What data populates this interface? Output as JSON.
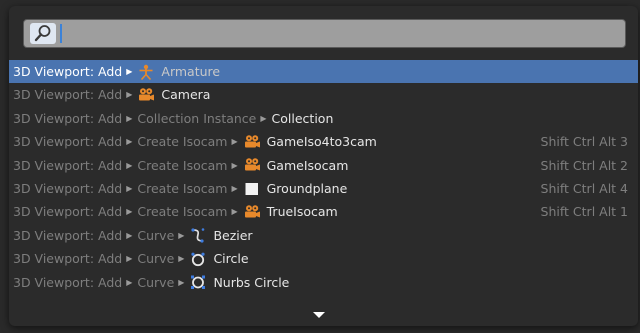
{
  "search": {
    "value": "",
    "placeholder": ""
  },
  "results": [
    {
      "path": [
        "3D Viewport: Add"
      ],
      "icon": "armature-icon",
      "label": "Armature",
      "shortcut": "",
      "selected": true
    },
    {
      "path": [
        "3D Viewport: Add"
      ],
      "icon": "camera-icon",
      "label": "Camera",
      "shortcut": "",
      "selected": false
    },
    {
      "path": [
        "3D Viewport: Add",
        "Collection Instance"
      ],
      "icon": "",
      "label": "Collection",
      "shortcut": "",
      "selected": false
    },
    {
      "path": [
        "3D Viewport: Add",
        "Create Isocam"
      ],
      "icon": "camera-icon",
      "label": "GameIso4to3cam",
      "shortcut": "Shift Ctrl Alt 3",
      "selected": false
    },
    {
      "path": [
        "3D Viewport: Add",
        "Create Isocam"
      ],
      "icon": "camera-icon",
      "label": "GameIsocam",
      "shortcut": "Shift Ctrl Alt 2",
      "selected": false
    },
    {
      "path": [
        "3D Viewport: Add",
        "Create Isocam"
      ],
      "icon": "plane-icon",
      "label": "Groundplane",
      "shortcut": "Shift Ctrl Alt 4",
      "selected": false
    },
    {
      "path": [
        "3D Viewport: Add",
        "Create Isocam"
      ],
      "icon": "camera-icon",
      "label": "TrueIsocam",
      "shortcut": "Shift Ctrl Alt 1",
      "selected": false
    },
    {
      "path": [
        "3D Viewport: Add",
        "Curve"
      ],
      "icon": "bezier-curve-icon",
      "label": "Bezier",
      "shortcut": "",
      "selected": false
    },
    {
      "path": [
        "3D Viewport: Add",
        "Curve"
      ],
      "icon": "circle-curve-icon",
      "label": "Circle",
      "shortcut": "",
      "selected": false
    },
    {
      "path": [
        "3D Viewport: Add",
        "Curve"
      ],
      "icon": "nurbs-circle-icon",
      "label": "Nurbs Circle",
      "shortcut": "",
      "selected": false
    }
  ],
  "colors": {
    "selection": "#4a74b0",
    "accent": "#e8892b",
    "caret": "#3b82d8"
  }
}
